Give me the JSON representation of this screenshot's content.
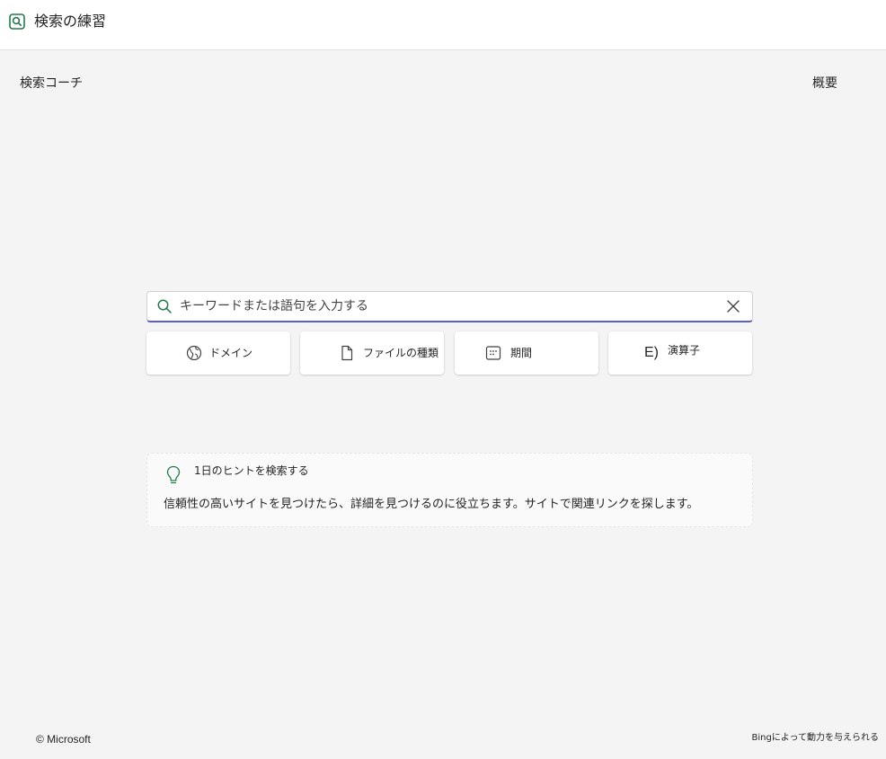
{
  "app": {
    "title": "検索の練習"
  },
  "nav": {
    "left_label": "検索コーチ",
    "right_label": "概要"
  },
  "search": {
    "value": "",
    "placeholder": "キーワードまたは語句を入力する"
  },
  "filters": [
    {
      "label": "ドメイン",
      "icon": "globe-icon"
    },
    {
      "label": "ファイルの種類",
      "icon": "document-icon"
    },
    {
      "label": "期間",
      "icon": "calendar-icon"
    },
    {
      "label": "演算子",
      "icon": "operator-icon",
      "glyph": "E)"
    }
  ],
  "tip": {
    "title": "1日のヒントを検索する",
    "body": "信頼性の高いサイトを見つけたら、詳細を見つけるのに役立ちます。サイトで関連リンクを探します。"
  },
  "footer": {
    "copyright": "© Microsoft",
    "powered_by": "Bingによって動力を与えられる"
  },
  "colors": {
    "accent": "#5b5fc7",
    "icon_green": "#237b4b",
    "background": "#f4f4f4"
  }
}
